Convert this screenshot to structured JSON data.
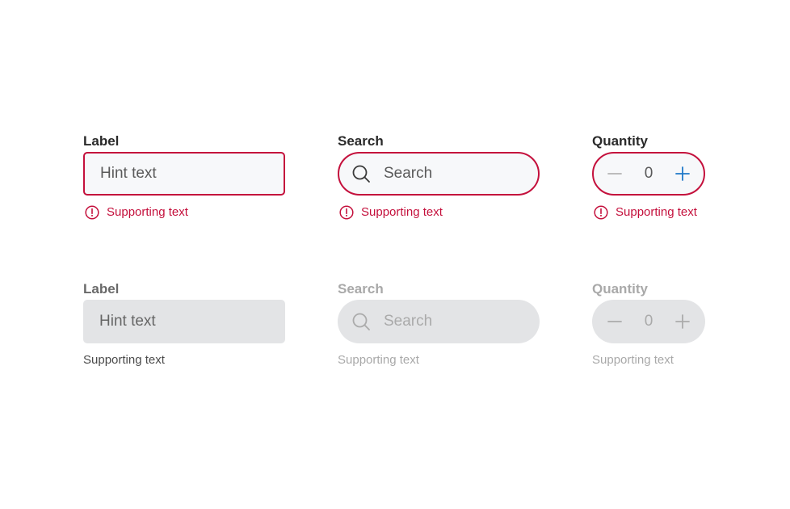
{
  "colors": {
    "error": "#c4103c",
    "input_background": "#f7f8fa",
    "disabled_background": "#e3e4e6",
    "accent_blue": "#1f78c8",
    "muted_text": "#a9a9a9"
  },
  "error_row": {
    "text_field": {
      "label": "Label",
      "hint": "Hint text",
      "supporting_text": "Supporting text",
      "icon": "alert-circle-icon"
    },
    "search_field": {
      "label": "Search",
      "placeholder": "Search",
      "supporting_text": "Supporting text",
      "icon": "search-icon"
    },
    "quantity_field": {
      "label": "Quantity",
      "value": "0",
      "supporting_text": "Supporting text",
      "decrement_icon": "minus-icon",
      "increment_icon": "plus-icon"
    }
  },
  "disabled_row": {
    "text_field": {
      "label": "Label",
      "hint": "Hint text",
      "supporting_text": "Supporting text"
    },
    "search_field": {
      "label": "Search",
      "placeholder": "Search",
      "supporting_text": "Supporting text",
      "icon": "search-icon"
    },
    "quantity_field": {
      "label": "Quantity",
      "value": "0",
      "supporting_text": "Supporting text",
      "decrement_icon": "minus-icon",
      "increment_icon": "plus-icon"
    }
  }
}
